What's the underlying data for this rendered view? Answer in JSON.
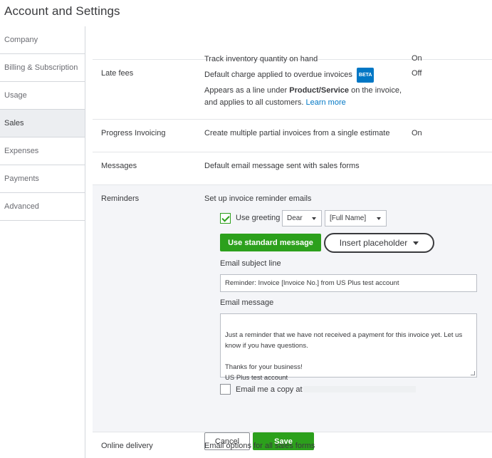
{
  "page": {
    "title": "Account and Settings"
  },
  "sidebar": {
    "items": [
      {
        "label": "Company"
      },
      {
        "label": "Billing & Subscription"
      },
      {
        "label": "Usage"
      },
      {
        "label": "Sales",
        "active": true
      },
      {
        "label": "Expenses"
      },
      {
        "label": "Payments"
      },
      {
        "label": "Advanced"
      }
    ]
  },
  "sales": {
    "inventory": {
      "description": "Track inventory quantity on hand",
      "value": "On"
    },
    "late_fees": {
      "label": "Late fees",
      "description": "Default charge applied to overdue invoices",
      "badge": "BETA",
      "value": "Off",
      "note_prefix": "Appears as a line under ",
      "note_bold": "Product/Service",
      "note_suffix": " on the invoice,",
      "note_line2": "and applies to all customers. ",
      "learn_more": "Learn more"
    },
    "progress_invoicing": {
      "label": "Progress Invoicing",
      "description": "Create multiple partial invoices from a single estimate",
      "value": "On"
    },
    "messages": {
      "label": "Messages",
      "description": "Default email message sent with sales forms"
    },
    "reminders": {
      "label": "Reminders",
      "description": "Set up invoice reminder emails",
      "use_greeting_label": "Use greeting",
      "use_greeting_checked": true,
      "greeting_select": "Dear",
      "name_select": "[Full Name]",
      "use_standard_button": "Use standard message",
      "insert_placeholder_button": "Insert placeholder",
      "subject_label": "Email subject line",
      "subject_value": "Reminder: Invoice [Invoice No.] from US Plus test account",
      "message_label": "Email message",
      "message_value": "Just a reminder that we have not received a payment for this invoice yet. Let us know if you have questions.\n\nThanks for your business!\nUS Plus test account",
      "email_copy_label": "Email me a copy at",
      "email_copy_checked": false,
      "cancel_button": "Cancel",
      "save_button": "Save"
    },
    "online_delivery": {
      "label": "Online delivery",
      "description": "Email options for all sales forms"
    }
  },
  "colors": {
    "accent_green": "#2ca01c",
    "link_blue": "#0077c5",
    "text": "#393a3d",
    "border": "#d4d7dc"
  }
}
